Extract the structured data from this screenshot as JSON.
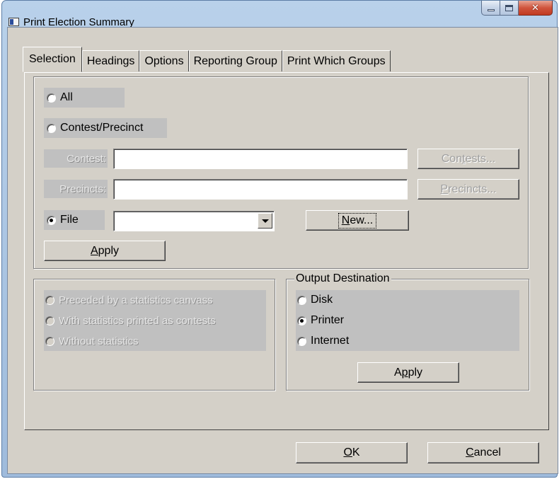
{
  "window": {
    "title": "Print Election Summary"
  },
  "tabs": [
    {
      "label": "Selection",
      "active": true
    },
    {
      "label": "Headings",
      "active": false
    },
    {
      "label": "Options",
      "active": false
    },
    {
      "label": "Reporting Group",
      "active": false
    },
    {
      "label": "Print Which Groups",
      "active": false
    }
  ],
  "selection": {
    "all_label": "All",
    "contest_precinct_label": "Contest/Precinct",
    "contest_field_label": "Contest:",
    "contest_value": "",
    "contests_button": {
      "pre": "Con",
      "ul": "t",
      "post": "ests..."
    },
    "precincts_field_label": "Precincts:",
    "precincts_value": "",
    "precincts_button": {
      "pre": "",
      "ul": "P",
      "post": "recincts..."
    },
    "file_label": "File",
    "file_value": "",
    "new_button": {
      "pre": "",
      "ul": "N",
      "post": "ew..."
    },
    "apply_button": {
      "pre": "",
      "ul": "A",
      "post": "pply"
    },
    "checked": "File"
  },
  "statistics": {
    "options": [
      "Preceded by a statistics canvass",
      "With statistics printed as contests",
      "Without statistics"
    ]
  },
  "output": {
    "legend": "Output Destination",
    "options": [
      "Disk",
      "Printer",
      "Internet"
    ],
    "checked": "Printer",
    "apply_button": {
      "pre": "A",
      "ul": "p",
      "post": "ply"
    }
  },
  "footer": {
    "ok_button": {
      "pre": "",
      "ul": "O",
      "post": "K"
    },
    "cancel_button": {
      "pre": "",
      "ul": "C",
      "post": "ancel"
    }
  }
}
